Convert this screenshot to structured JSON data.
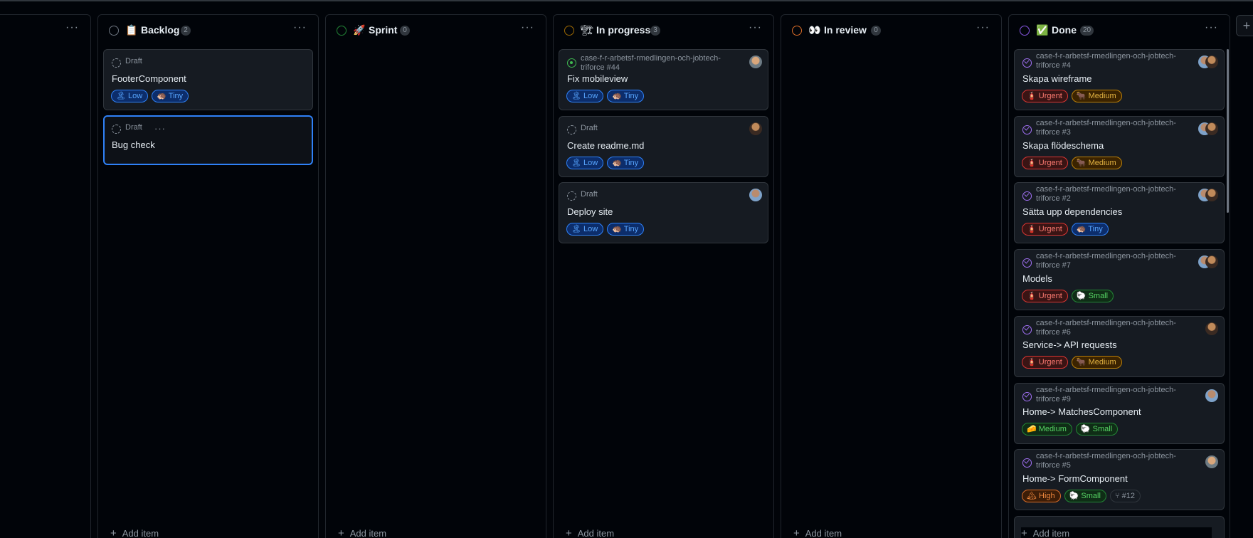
{
  "columns": [
    {
      "title": "",
      "emoji": "",
      "count": "",
      "dots": "···",
      "add": ""
    },
    {
      "title": "Backlog",
      "emoji": "📋",
      "count": "2",
      "dots": "···",
      "add": "Add item",
      "status_color": "#6e7681",
      "cards": [
        {
          "meta": "Draft",
          "title": "FooterComponent",
          "labels": [
            {
              "text": "Low",
              "emoji": "🏝"
            },
            {
              "text": "Tiny",
              "emoji": "🦔"
            }
          ]
        },
        {
          "meta": "Draft",
          "title": "Bug check"
        }
      ]
    },
    {
      "title": "Sprint",
      "emoji": "🚀",
      "count": "0",
      "dots": "···",
      "add": "Add item",
      "status_color": "#238636"
    },
    {
      "title": "In progress",
      "emoji": "🏗",
      "count": "3",
      "dots": "···",
      "add": "Add item",
      "status_color": "#9e6a03",
      "cards": [
        {
          "meta": "case-f-r-arbetsf-rmedlingen-och-jobtech-triforce #44",
          "title": "Fix mobileview",
          "labels": [
            {
              "text": "Low",
              "emoji": "🏝"
            },
            {
              "text": "Tiny",
              "emoji": "🦔"
            }
          ]
        },
        {
          "meta": "Draft",
          "title": "Create readme.md",
          "labels": [
            {
              "text": "Low",
              "emoji": "🏝"
            },
            {
              "text": "Tiny",
              "emoji": "🦔"
            }
          ]
        },
        {
          "meta": "Draft",
          "title": "Deploy site",
          "labels": [
            {
              "text": "Low",
              "emoji": "🏝"
            },
            {
              "text": "Tiny",
              "emoji": "🦔"
            }
          ]
        }
      ]
    },
    {
      "title": "In review",
      "emoji": "👀",
      "count": "0",
      "dots": "···",
      "add": "Add item",
      "status_color": "#db6d28"
    },
    {
      "title": "Done",
      "emoji": "✅",
      "count": "20",
      "dots": "···",
      "add": "Add item",
      "status_color": "#8957e5",
      "cards": [
        {
          "meta": "case-f-r-arbetsf-rmedlingen-och-jobtech-triforce #4",
          "title": "Skapa wireframe",
          "labels": [
            {
              "text": "Urgent",
              "emoji": "🧯"
            },
            {
              "text": "Medium",
              "emoji": "🐂"
            }
          ]
        },
        {
          "meta": "case-f-r-arbetsf-rmedlingen-och-jobtech-triforce #3",
          "title": "Skapa flödeschema",
          "labels": [
            {
              "text": "Urgent",
              "emoji": "🧯"
            },
            {
              "text": "Medium",
              "emoji": "🐂"
            }
          ]
        },
        {
          "meta": "case-f-r-arbetsf-rmedlingen-och-jobtech-triforce #2",
          "title": "Sätta upp dependencies",
          "labels": [
            {
              "text": "Urgent",
              "emoji": "🧯"
            },
            {
              "text": "Tiny",
              "emoji": "🦔"
            }
          ]
        },
        {
          "meta": "case-f-r-arbetsf-rmedlingen-och-jobtech-triforce #7",
          "title": "Models",
          "labels": [
            {
              "text": "Urgent",
              "emoji": "🧯"
            },
            {
              "text": "Small",
              "emoji": "🐑"
            }
          ]
        },
        {
          "meta": "case-f-r-arbetsf-rmedlingen-och-jobtech-triforce #6",
          "title": "Service-> API requests",
          "labels": [
            {
              "text": "Urgent",
              "emoji": "🧯"
            },
            {
              "text": "Medium",
              "emoji": "🐂"
            }
          ]
        },
        {
          "meta": "case-f-r-arbetsf-rmedlingen-och-jobtech-triforce #9",
          "title": "Home-> MatchesComponent",
          "labels": [
            {
              "text": "Medium",
              "emoji": "🧀"
            },
            {
              "text": "Small",
              "emoji": "🐑"
            }
          ]
        },
        {
          "meta": "case-f-r-arbetsf-rmedlingen-och-jobtech-triforce #5",
          "title": "Home-> FormComponent",
          "labels": [
            {
              "text": "High",
              "emoji": "🏔"
            },
            {
              "text": "Small",
              "emoji": "🐑"
            },
            {
              "text": "#12",
              "emoji": "⑂"
            }
          ]
        }
      ]
    }
  ],
  "add_column_icon": "plus-icon",
  "add_column_label": "+"
}
